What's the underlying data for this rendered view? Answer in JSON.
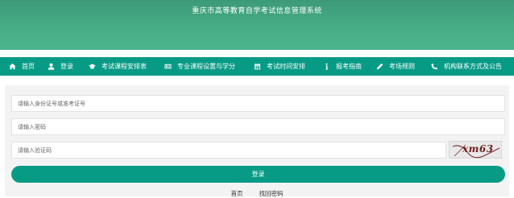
{
  "header": {
    "title": "重庆市高等教育自学考试信息管理系统"
  },
  "nav": {
    "items": [
      {
        "label": "首页",
        "icon": "home-icon"
      },
      {
        "label": "登录",
        "icon": "user-icon"
      },
      {
        "label": "考试课程安排表",
        "icon": "graduation-cap-icon"
      },
      {
        "label": "专业课程设置与学分",
        "icon": "id-card-icon"
      },
      {
        "label": "考试时间安排",
        "icon": "calendar-icon"
      },
      {
        "label": "报考指南",
        "icon": "info-icon"
      },
      {
        "label": "考场规则",
        "icon": "pencil-icon"
      },
      {
        "label": "机构联系方式及公告",
        "icon": "phone-icon"
      }
    ]
  },
  "form": {
    "id_placeholder": "请输入身份证号或准考证号",
    "password_placeholder": "请输入密码",
    "captcha_placeholder": "请输入验证码",
    "captcha_text": "xm63",
    "login_label": "登录"
  },
  "footer": {
    "home_link": "首页",
    "recover_link": "找回密码"
  },
  "colors": {
    "header_green": "#46ad86",
    "nav_teal": "#079b86",
    "button_teal": "#079b86"
  }
}
